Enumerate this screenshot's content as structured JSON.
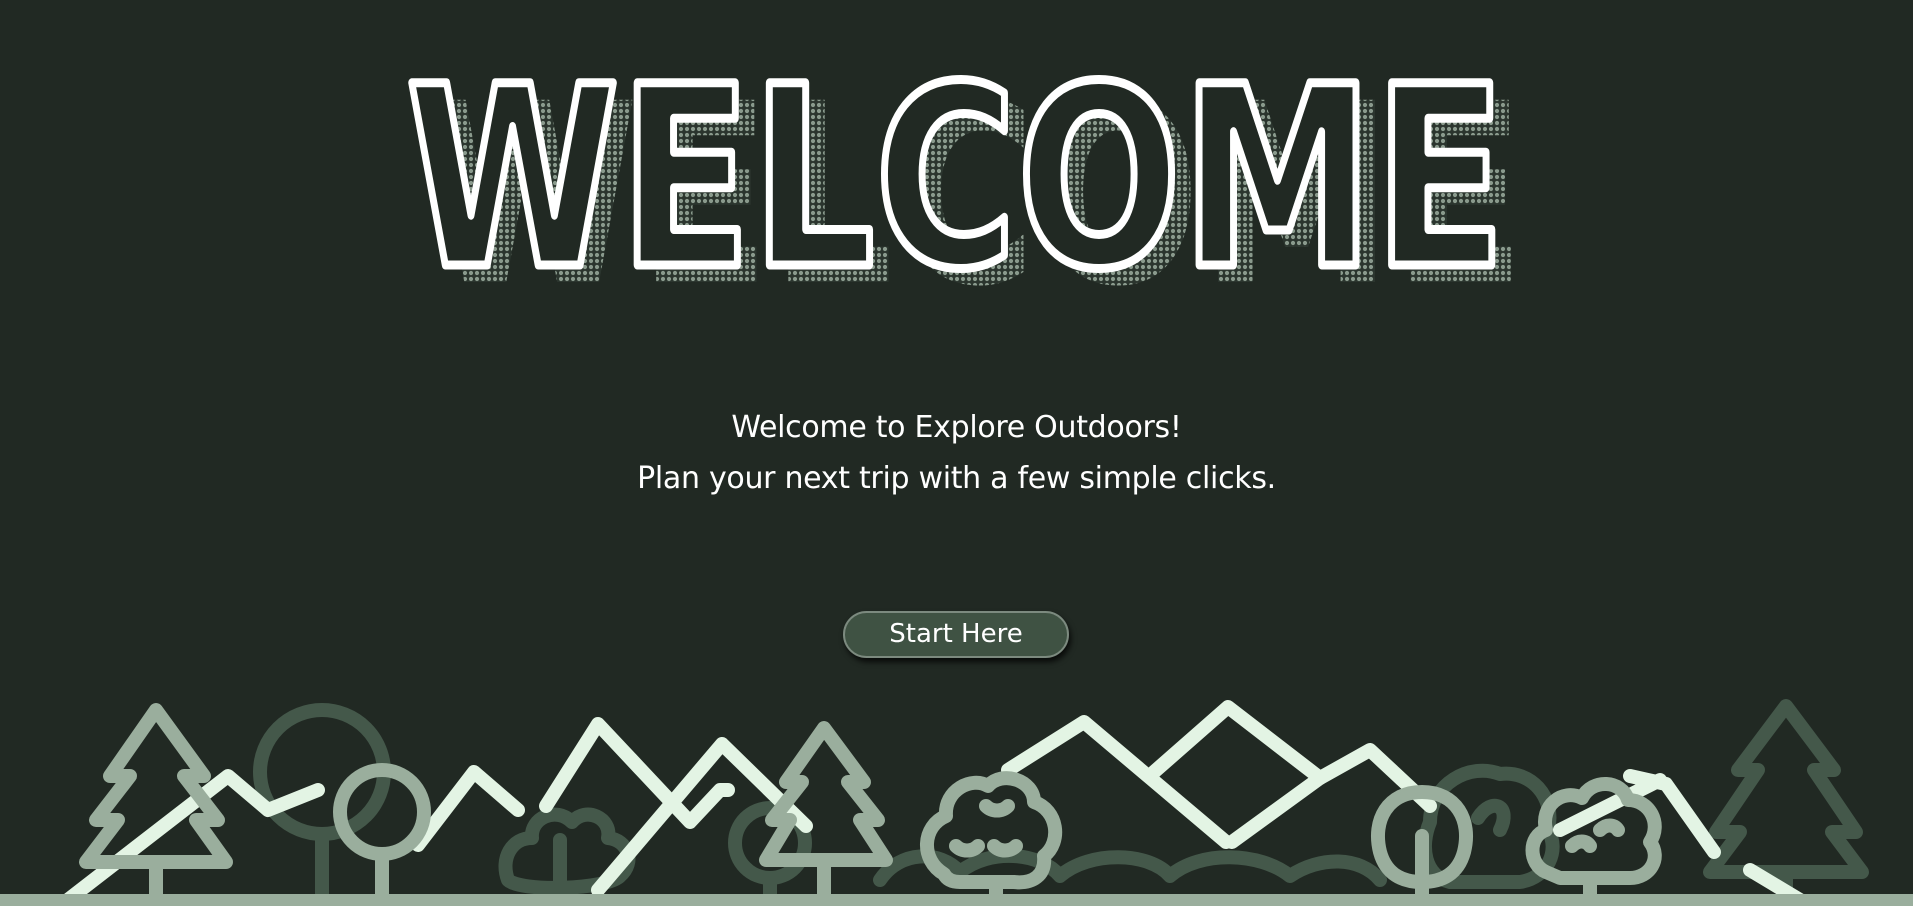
{
  "hero": {
    "title": "WELCOME"
  },
  "intro": {
    "line1": "Welcome to Explore Outdoors!",
    "line2": "Plan your next trip with a few simple clicks."
  },
  "cta": {
    "label": "Start Here"
  },
  "colors": {
    "background": "#212923",
    "title_stroke": "#ffffff",
    "title_shadow": "#8a9a8d",
    "button_fill": "#3f5243",
    "mountain_light": "#e3f4e4",
    "tree_mid": "#9aae9d",
    "tree_dark": "#44584a"
  },
  "icons": [
    "pine-tree-icon",
    "round-tree-icon",
    "bush-icon",
    "mountain-icon"
  ]
}
